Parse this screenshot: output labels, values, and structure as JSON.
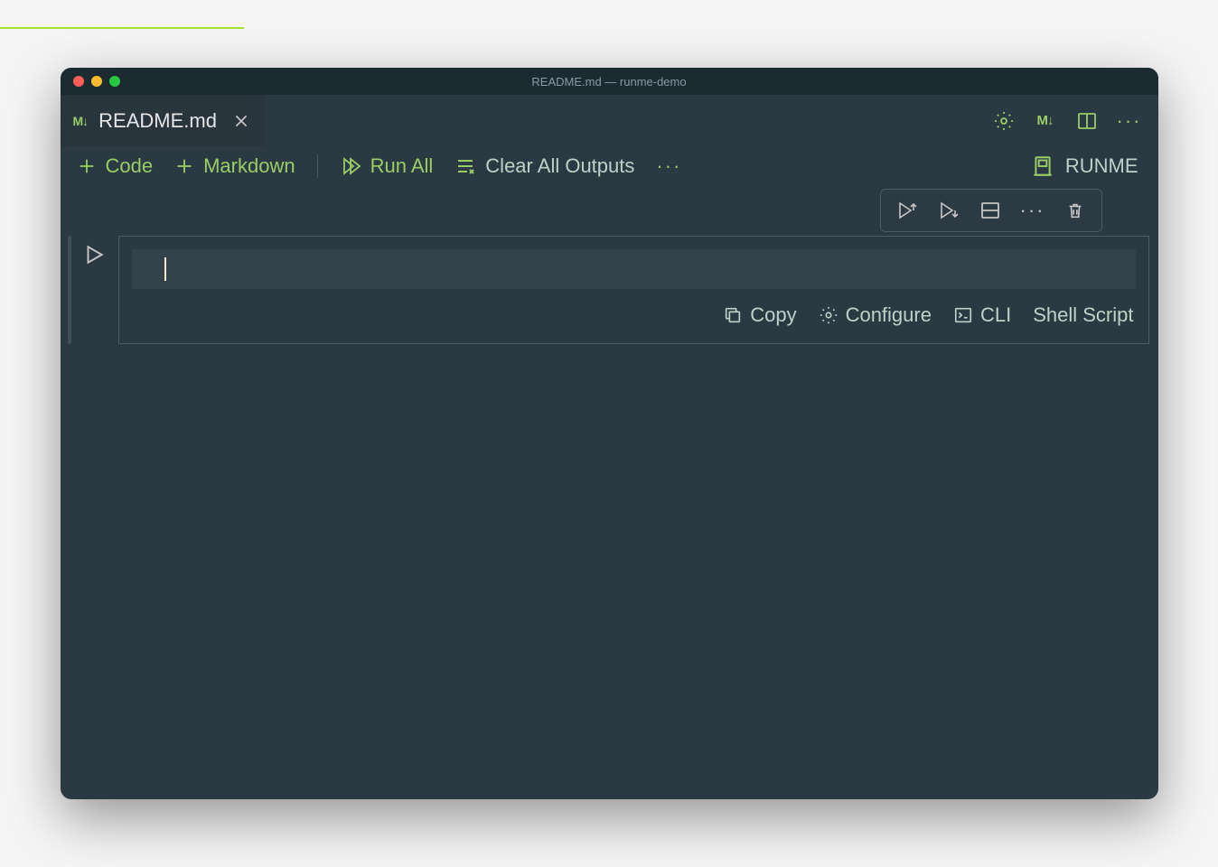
{
  "titlebar": {
    "title": "README.md — runme-demo"
  },
  "tab": {
    "filename": "README.md"
  },
  "toolbar": {
    "code": "Code",
    "markdown": "Markdown",
    "run_all": "Run All",
    "clear_outputs": "Clear All Outputs"
  },
  "kernel": {
    "label": "RUNME"
  },
  "cell_status": {
    "copy": "Copy",
    "configure": "Configure",
    "cli": "CLI",
    "language": "Shell Script"
  }
}
